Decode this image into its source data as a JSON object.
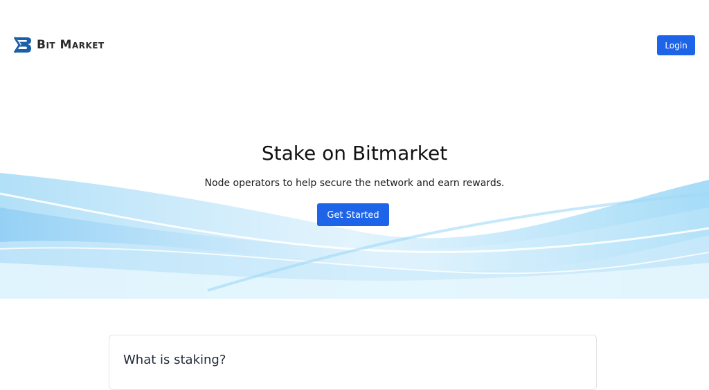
{
  "brand": {
    "name": "Bit Market"
  },
  "header": {
    "login_label": "Login"
  },
  "hero": {
    "title": "Stake on Bitmarket",
    "subtitle": "Node operators to help secure the network and earn rewards.",
    "cta_label": "Get Started"
  },
  "faq": {
    "first_question": "What is staking?"
  },
  "colors": {
    "primary": "#1d64e8",
    "logo": "#1a5fa8",
    "wave": "#8fd3f5"
  },
  "icons": {
    "logo": "bit-market-logo-icon"
  }
}
